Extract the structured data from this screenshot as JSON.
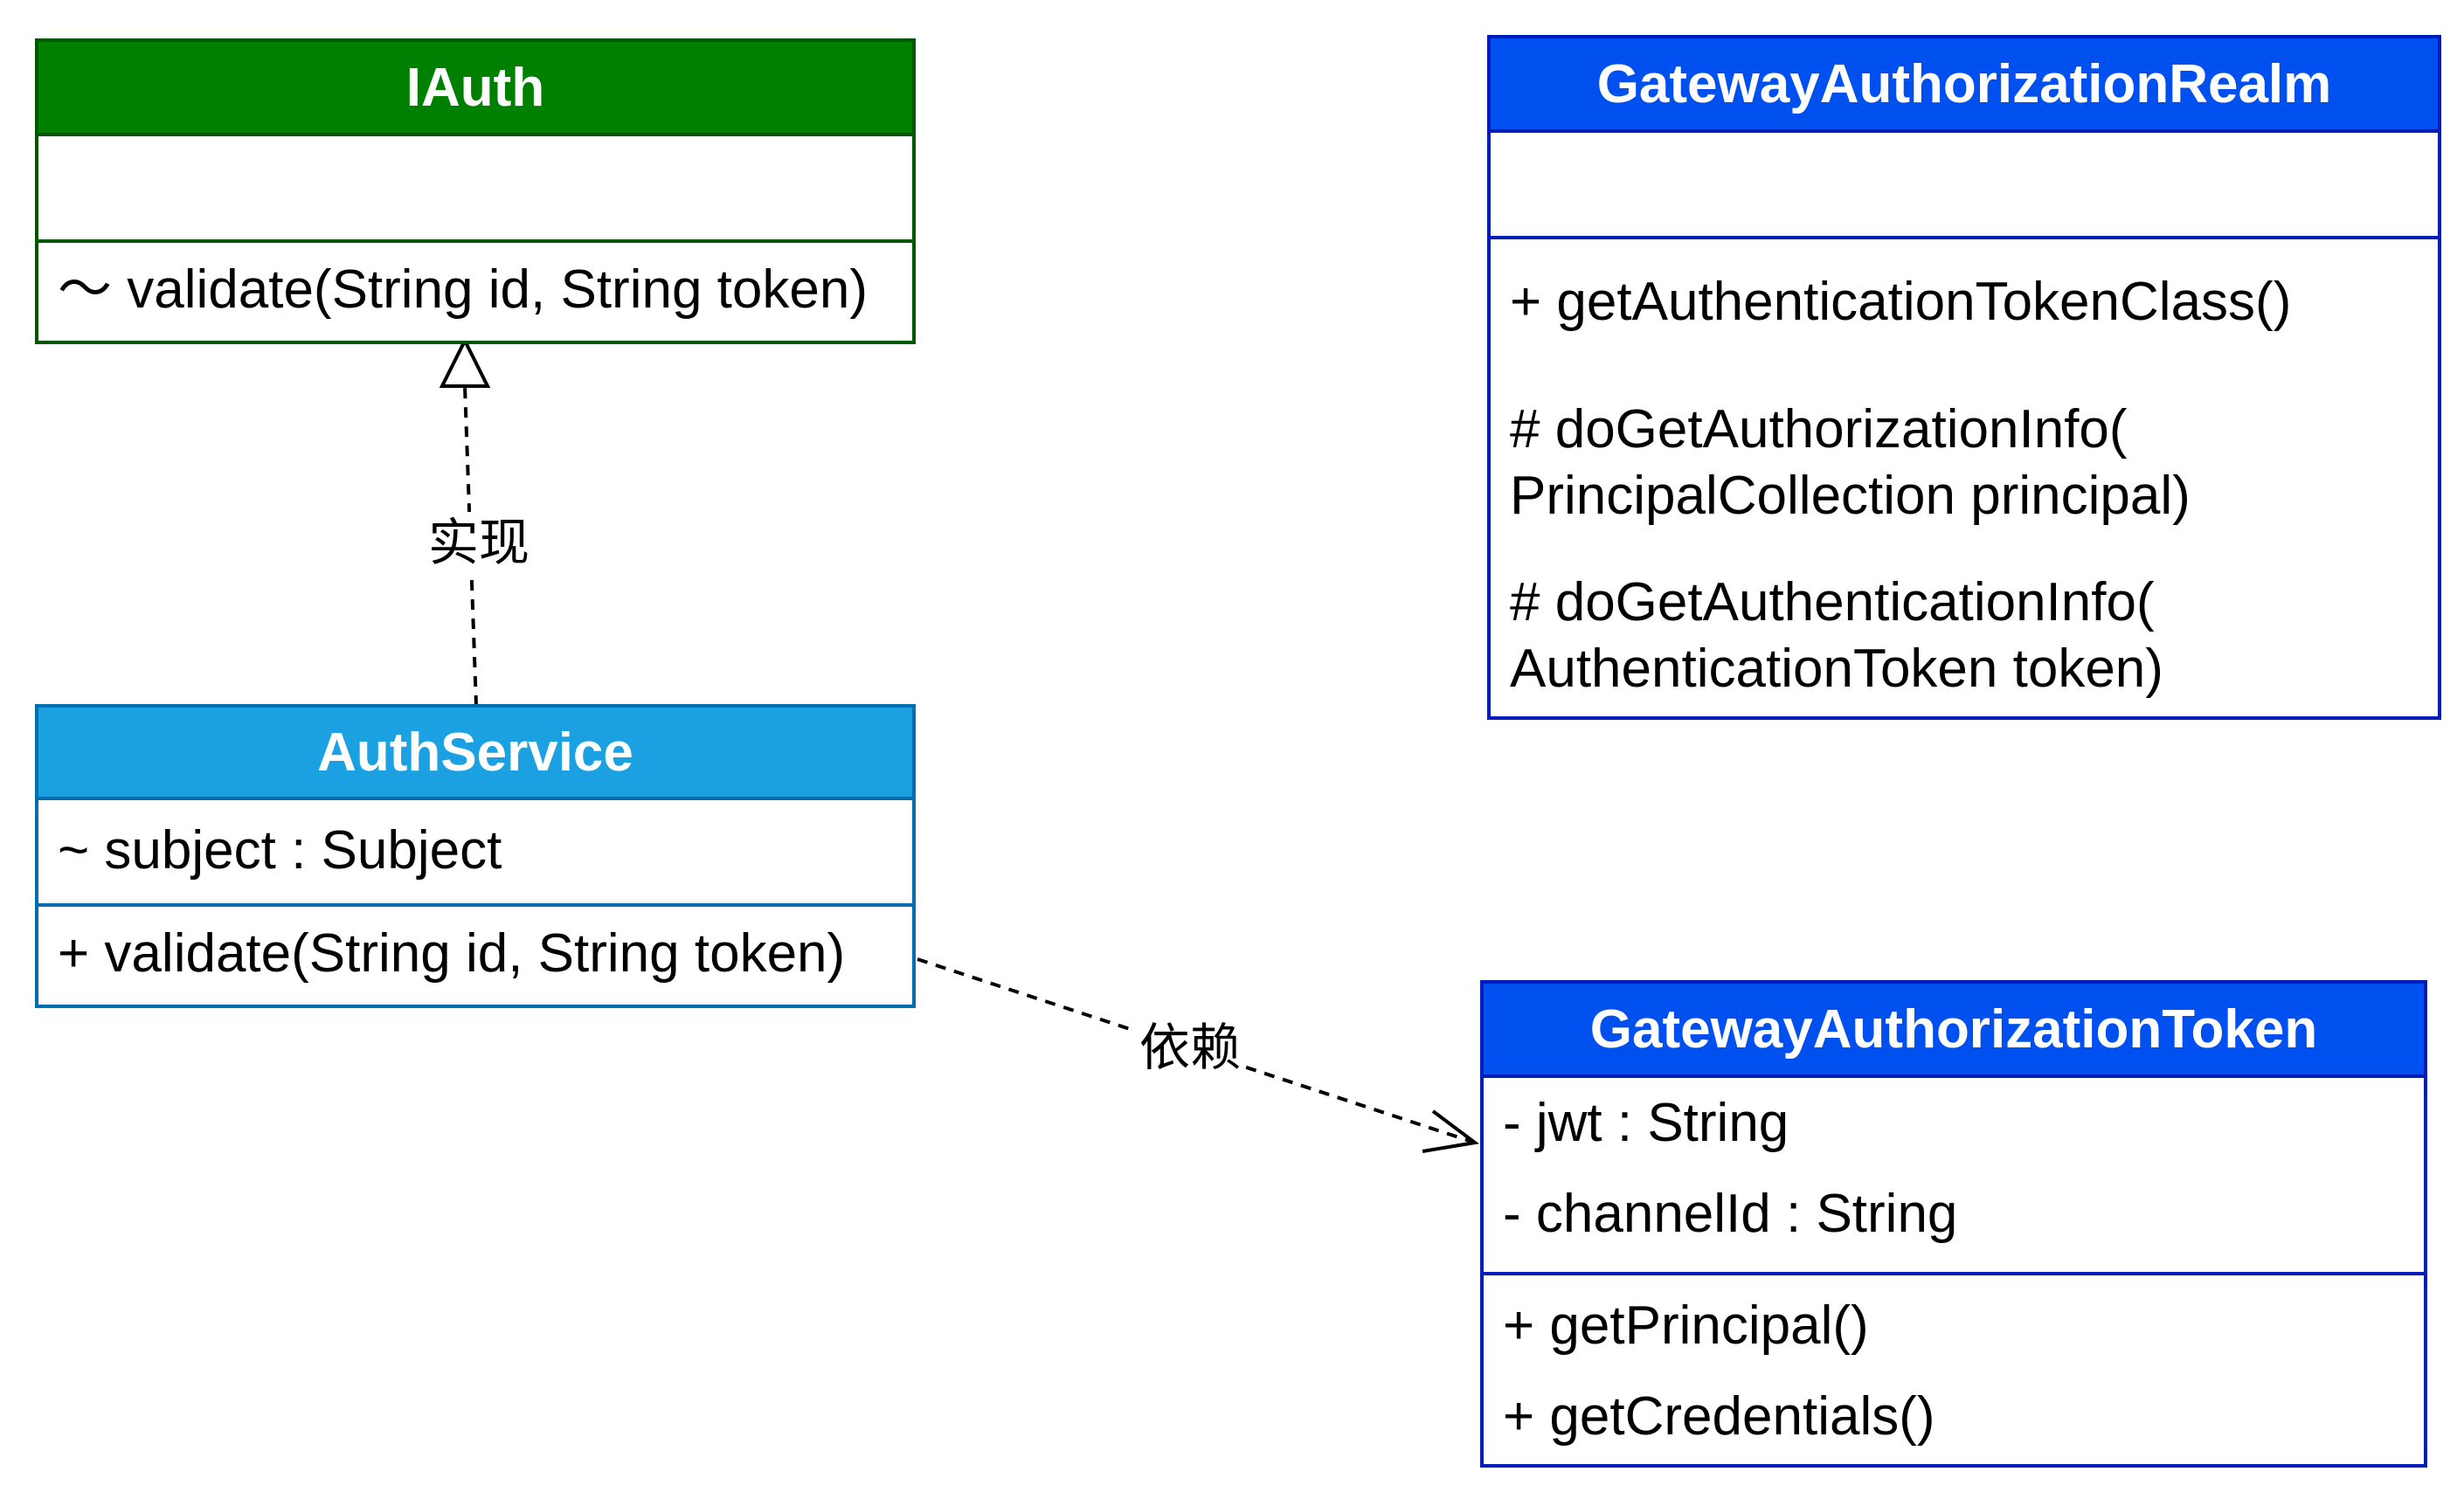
{
  "colors": {
    "interface_header": "#008000",
    "interface_border": "#005700",
    "service_header": "#1BA1E2",
    "service_border": "#006EAF",
    "realm_header": "#0050EF",
    "realm_border": "#001DBC",
    "edge": "#000000"
  },
  "classes": {
    "iauth": {
      "name": "IAuth",
      "attributes": [],
      "methods": [
        "～ validate(String id, String token)"
      ]
    },
    "auth_service": {
      "name": "AuthService",
      "attributes": [
        "~ subject : Subject"
      ],
      "methods": [
        "+ validate(String id, String token)"
      ]
    },
    "realm": {
      "name": "GatewayAuthorizationRealm",
      "attributes": [],
      "methods": [
        "+ getAuthenticationTokenClass()",
        "# doGetAuthorizationInfo(",
        "PrincipalCollection principal)",
        "# doGetAuthenticationInfo(",
        "AuthenticationToken token)"
      ]
    },
    "token": {
      "name": "GatewayAuthorizationToken",
      "attributes": [
        "- jwt : String",
        "- channelId : String"
      ],
      "methods": [
        "+ getPrincipal()",
        "+ getCredentials()"
      ]
    }
  },
  "relations": {
    "realization": {
      "from": "AuthService",
      "to": "IAuth",
      "label": "实现",
      "kind": "realization"
    },
    "dependency": {
      "from": "AuthService",
      "to": "GatewayAuthorizationToken",
      "label": "依赖",
      "kind": "dependency"
    }
  }
}
